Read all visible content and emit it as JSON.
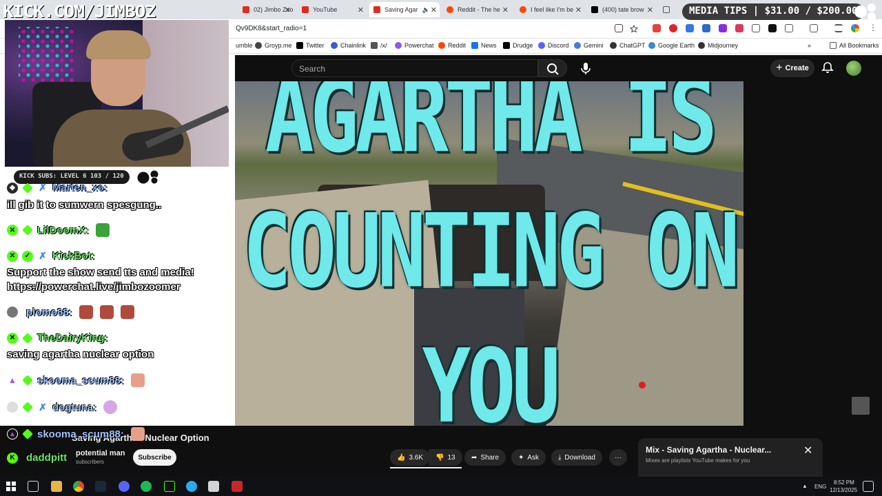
{
  "browser": {
    "tabs": [
      {
        "label": "02) Jimbo Zoo",
        "color": "#e02b20"
      },
      {
        "label": "YouTube",
        "color": "#e02b20"
      },
      {
        "label": "Saving Agar",
        "color": "#e02b20",
        "active": true
      },
      {
        "label": "Reddit - The he",
        "color": "#ff4500"
      },
      {
        "label": "I feel like I'm be",
        "color": "#ff4500"
      },
      {
        "label": "(400) tate brow",
        "color": "#000000"
      }
    ],
    "url": "Qv9DK8&start_radio=1",
    "bookmarks": [
      "umble",
      "Groyp.me",
      "Twitter",
      "Chainlink",
      "/x/",
      "Powerchat",
      "Reddit",
      "News",
      "Drudge",
      "Discord",
      "Gemini",
      "ChatGPT",
      "Google Earth",
      "Midjourney"
    ],
    "all_bookmarks": "All Bookmarks"
  },
  "overlay": {
    "brand": "KICK.COM/JIMBOZ",
    "media_tips": "MEDIA TIPS | $31.00 / $200.00",
    "kick_subs": "KICK SUBS: LEVEL 6 103 / 120"
  },
  "chat": [
    {
      "user": "Marten_xo:",
      "user_color": "#7fb0ff",
      "text": "ill gib it to sumwern spesgung.."
    },
    {
      "user": "LilDoomX:",
      "user_color": "#6ee36b",
      "text": ""
    },
    {
      "user": "KickBot:",
      "user_color": "#6ee36b",
      "text": "Support the show send tts and media!",
      "text2": "https://powerchat.live/jimbozoomer"
    },
    {
      "user": "plomo88:",
      "user_color": "#9fc3ff",
      "text": ""
    },
    {
      "user": "TheDairyKing:",
      "user_color": "#6ee36b",
      "text": "saving agartha nuclear option"
    },
    {
      "user": "skooma_scum88:",
      "user_color": "#9fc3ff",
      "text": ""
    },
    {
      "user": "dogtuna:",
      "user_color": "#9fc3ff",
      "text": ""
    },
    {
      "user": "skooma_scum88:",
      "user_color": "#9fc3ff",
      "text": ""
    },
    {
      "user": "daddpitt",
      "user_color": "#6ee36b",
      "text": ""
    }
  ],
  "youtube": {
    "search_placeholder": "Search",
    "create_label": "Create",
    "video_text_lines": [
      "AGARTHA IS",
      "COUNTING ON",
      "YOU"
    ],
    "video_title": "Saving Agartha - Nuclear Option",
    "channel": "potential man",
    "subscribers": "subscribers",
    "subscribe_label": "Subscribe",
    "likes": "3.6K",
    "dislikes": "13",
    "share_label": "Share",
    "ask_label": "Ask",
    "download_label": "Download",
    "mix_title": "Mix - Saving Agartha - Nuclear...",
    "mix_subtitle": "Mixes are playlists YouTube makes for you"
  },
  "taskbar": {
    "lang": "ENG",
    "time": "8:52 PM",
    "date": "12/13/2025"
  }
}
